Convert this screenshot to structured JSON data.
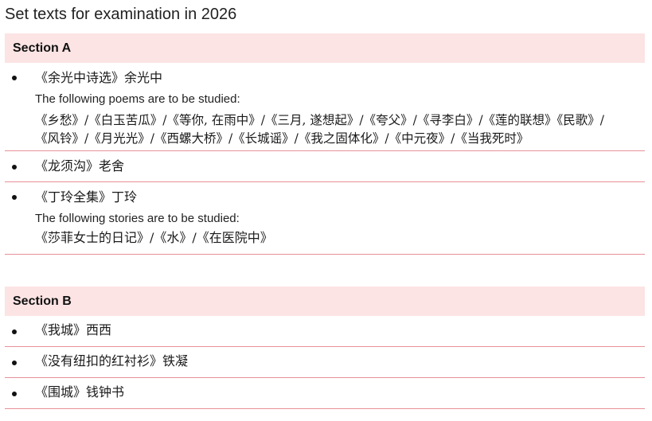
{
  "title": "Set texts for examination in 2026",
  "sections": [
    {
      "label": "Section A",
      "items": [
        {
          "work": "《余光中诗选》余光中",
          "note": "The following poems are to be studied:",
          "details": [
            "《乡愁》/《白玉苦瓜》/《等你, 在雨中》/《三月, 遂想起》/《夸父》/《寻李白》/《莲的联想》《民歌》/",
            "《风铃》/《月光光》/《西螺大桥》/《长城谣》/《我之固体化》/《中元夜》/《当我死时》"
          ]
        },
        {
          "work": "《龙须沟》老舍"
        },
        {
          "work": "《丁玲全集》丁玲",
          "note": "The following stories are to be studied:",
          "details": [
            "《莎菲女士的日记》/《水》/《在医院中》"
          ]
        }
      ]
    },
    {
      "label": "Section B",
      "items": [
        {
          "work": "《我城》西西"
        },
        {
          "work": "《没有纽扣的红衬衫》铁凝"
        },
        {
          "work": "《围城》钱钟书"
        }
      ]
    }
  ],
  "colors": {
    "header_bg": "#fce4e4",
    "divider": "#e8909a"
  }
}
